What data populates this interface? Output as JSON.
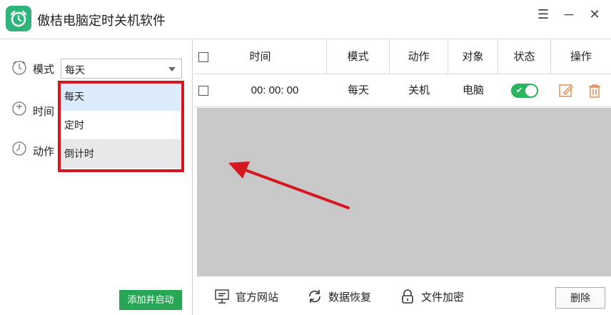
{
  "app": {
    "title": "傲桔电脑定时关机软件",
    "accent": "#2fb57b"
  },
  "window_controls": {
    "menu": "☰",
    "minimize": "─",
    "close": "✕"
  },
  "left": {
    "mode_label": "模式",
    "time_label": "时间",
    "action_label": "动作",
    "mode_select": {
      "value": "每天",
      "options": [
        "每天",
        "定时",
        "倒计时"
      ]
    },
    "add_button": "添加并启动",
    "add_button_color": "#27a755"
  },
  "table": {
    "headers": [
      "时间",
      "模式",
      "动作",
      "对象",
      "状态",
      "操作"
    ],
    "rows": [
      {
        "time": "00: 00: 00",
        "mode": "每天",
        "action": "关机",
        "target": "电脑",
        "status_on": true
      }
    ]
  },
  "bottom": {
    "website": "官方网站",
    "restore": "数据恢复",
    "encrypt": "文件加密",
    "delete": "删除"
  },
  "highlight_color": "#d7171f"
}
